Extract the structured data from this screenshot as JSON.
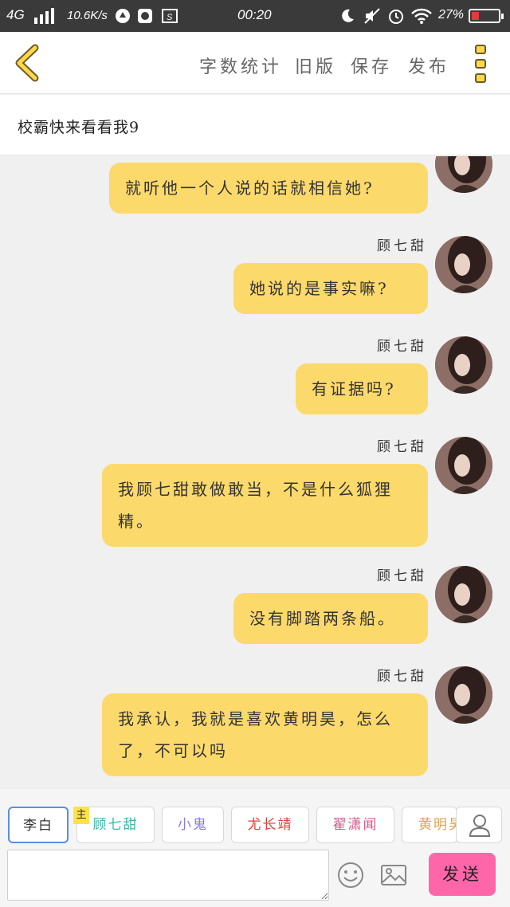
{
  "status_bar": {
    "network": "4G",
    "speed": "10.6K/s",
    "time": "00:20",
    "battery": "27%",
    "battery_level": 0.27,
    "icons": [
      "signal-icon",
      "traffic-icon",
      "app-icon",
      "screenshot-icon",
      "moon-icon",
      "mute-icon",
      "alarm-icon",
      "wifi-icon",
      "battery-icon"
    ]
  },
  "header": {
    "menu": [
      {
        "label": "字数统计"
      },
      {
        "label": "旧版"
      },
      {
        "label": "保存"
      },
      {
        "label": "发布"
      }
    ],
    "accent_color": "#ffd84a"
  },
  "title": "校霸快来看看我9",
  "messages": [
    {
      "sender": "",
      "text": "就听他一个人说的话就相信她?"
    },
    {
      "sender": "顾七甜",
      "text": "她说的是事实嘛?"
    },
    {
      "sender": "顾七甜",
      "text": "有证据吗?"
    },
    {
      "sender": "顾七甜",
      "text": "我顾七甜敢做敢当，不是什么狐狸精。"
    },
    {
      "sender": "顾七甜",
      "text": "没有脚踏两条船。"
    },
    {
      "sender": "顾七甜",
      "text": "我承认，我就是喜欢黄明昊，怎么了，不可以吗"
    }
  ],
  "roles": {
    "main_badge": "主",
    "items": [
      {
        "name": "李白",
        "color": "#333333"
      },
      {
        "name": "顾七甜",
        "color": "#3bb8a8"
      },
      {
        "name": "小鬼",
        "color": "#8a7ae0"
      },
      {
        "name": "尤长靖",
        "color": "#e0403a"
      },
      {
        "name": "翟潇闻",
        "color": "#d65a8a"
      },
      {
        "name": "黄明昊",
        "color": "#e0a050"
      }
    ]
  },
  "input": {
    "value": "",
    "send_label": "发送"
  },
  "colors": {
    "bubble": "#fcd96b",
    "send": "#ff66aa",
    "selected_border": "#5b8de0"
  }
}
